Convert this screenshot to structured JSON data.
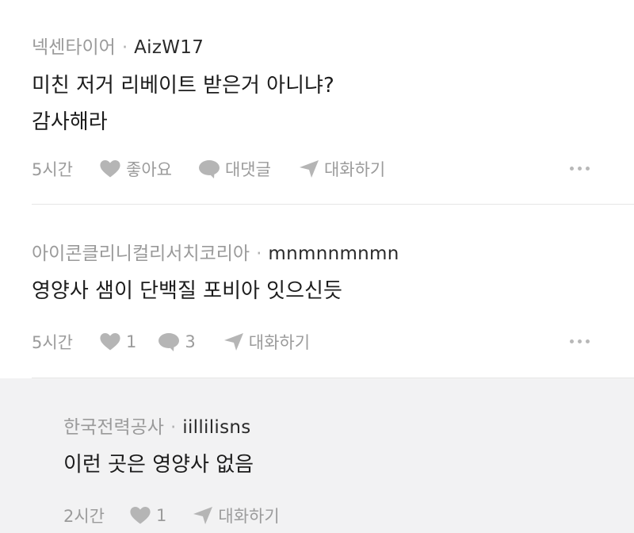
{
  "comments": [
    {
      "company": "넥센타이어",
      "username": "AizW17",
      "lines": [
        "미친 저거 리베이트 받은거 아니냐?",
        "감사해라"
      ],
      "time": "5시간",
      "like_label": "좋아요",
      "reply_label": "대댓글",
      "chat_label": "대화하기"
    },
    {
      "company": "아이콘클리니컬리서치코리아",
      "username": "mnmnnmnmn",
      "lines": [
        "영양사 샘이 단백질 포비아 잇으신듯"
      ],
      "time": "5시간",
      "like_label": "1",
      "reply_label": "3",
      "chat_label": "대화하기"
    },
    {
      "company": "한국전력공사",
      "username": "iillilisns",
      "lines": [
        "이런 곳은 영양사 없음"
      ],
      "time": "2시간",
      "like_label": "1",
      "chat_label": "대화하기"
    }
  ],
  "separator": "·",
  "icons": {
    "like": "heart-icon",
    "reply": "speech-bubble-icon",
    "chat": "paper-plane-icon",
    "more": "more-dots-icon"
  },
  "colors": {
    "reply_background": "#f2f2f3",
    "icon_gray": "#b5b5b5",
    "text_gray": "#9b9b9b"
  }
}
